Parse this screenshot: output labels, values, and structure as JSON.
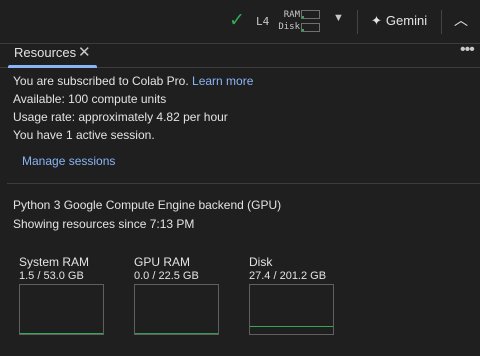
{
  "toolbar": {
    "runtime_label": "L4",
    "ram_label": "RAM",
    "disk_label": "Disk",
    "ram_fraction": 0.03,
    "disk_fraction": 0.14,
    "connected_icon": "check-icon",
    "gemini_label": "Gemini",
    "accent_color": "#34a853"
  },
  "tabs": [
    {
      "label": "Resources"
    }
  ],
  "subscription": {
    "line1_prefix": "You are subscribed to Colab Pro.",
    "learn_more": "Learn more",
    "available": "Available: 100 compute units",
    "usage_rate": "Usage rate: approximately 4.82 per hour",
    "sessions": "You have 1 active session.",
    "manage_sessions": "Manage sessions"
  },
  "backend": {
    "title": "Python 3 Google Compute Engine backend (GPU)",
    "since": "Showing resources since 7:13 PM"
  },
  "resources": [
    {
      "label": "System RAM",
      "value": "1.5 / 53.0 GB",
      "fraction": 0.028
    },
    {
      "label": "GPU RAM",
      "value": "0.0 / 22.5 GB",
      "fraction": 0.0
    },
    {
      "label": "Disk",
      "value": "27.4 / 201.2 GB",
      "fraction": 0.136
    }
  ]
}
